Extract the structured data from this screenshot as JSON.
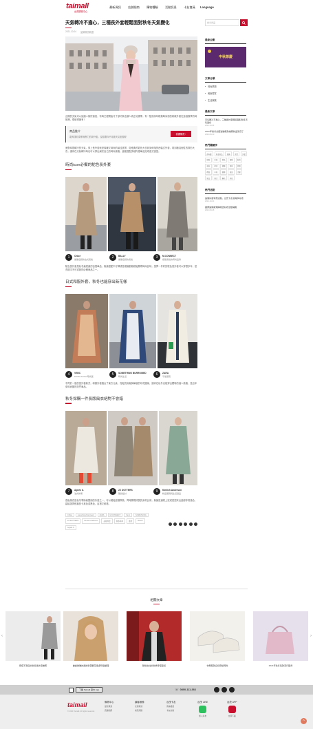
{
  "header": {
    "logo_text": "taimall",
    "logo_sub": "台茂購物中心",
    "nav": [
      "最新資訊",
      "店舖指南",
      "購物體驗",
      "活動訊息",
      "卡友會員",
      "Language"
    ]
  },
  "article": {
    "title": "天氣轉冷不擔心，三種長外套輕鬆面對秋冬天氣變化",
    "meta": [
      "2021.10.04",
      "品牌資訊精選"
    ],
    "intro": "近期的天氣可以說讓人無所適從，有時已經開始冷了卻又無法讓人真正地換季，有一點保持年輕與時尚感的精緻外套在這個換季的時節裡，很值得擁有！",
    "cta": {
      "title": "商品推介",
      "desc": "能夠讓你換季無壓力的新外套，還想要你不用被天氣困擾喔",
      "button": "我要購買 ›"
    },
    "intro2": "面對時間轉冷的天氣，穿上長外套就是保暖又時尚的最佳選擇，從經典的駝色大衣到到俐落的西裝式外套，再到極具個性的廓形大衣，讓你在天氣轉冷時也可以穿出屬於自己的時尚風格，還能搭配多種內搭單品完成各式造型。",
    "sections": [
      {
        "title": "時尚icon必備的駝色長外套",
        "brands": [
          {
            "num": "1",
            "name": "Chloé",
            "desc": "優雅低調的法式風格"
          },
          {
            "num": "2",
            "name": "BALLY",
            "desc": "優雅低調的風格"
          },
          {
            "num": "3",
            "name": "M.CONNECT",
            "desc": "極簡風格的時尚品牌"
          }
        ],
        "text": "駝色長外套是秋冬最經典的百搭單品，無論搭配牛仔褲或是裙裝都能輕鬆展現時尚品味，選擇一件好的駝色長外套可以穿很多年，是衣櫥中不可或缺的必備單品之一。"
      },
      {
        "title": "日式和服外套，秋冬也能穿出新花樣",
        "brands": [
          {
            "num": "4",
            "name": "VENC",
            "desc": "MODA ALISA 時尚選"
          },
          {
            "num": "5",
            "name": "SOMETHING BURROWED",
            "desc": "時尚生活"
          },
          {
            "num": "6",
            "name": "ZARA",
            "desc": "平價潮流"
          }
        ],
        "text": "不同於一般的長外套款式，和服外套融合了東方元素，寬鬆的剪裁與華麗的印花圖案，讓你在秋冬也能穿出獨特的個人風格，是近年來時尚圈的熱門單品。"
      },
      {
        "title": "秋冬採購一件長版風衣絕對不會錯",
        "brands": [
          {
            "num": "7",
            "name": "Agnès b.",
            "desc": "法式休閒"
          },
          {
            "num": "8",
            "name": "ZZ DOTTERS",
            "desc": "獨創設計"
          },
          {
            "num": "9",
            "name": "Kimiich Anderson",
            "desc": "精品服飾與生活選品"
          }
        ],
        "text": "長版風衣是秋冬季節最實用的外套之一，可以輕鬆遮擋寒風，同時展現修長的身材比例，無論是通勤上班或是週末出遊都非常適合，建議選擇經典的卡其色或黑色，百搭又耐看。"
      }
    ],
    "tags": [
      "Chloé",
      "something Burrowed",
      "ZARA",
      "M.CONNECT",
      "Venc",
      "SOMETHING",
      "ZZ DOTTERS",
      "Kimiich Anderson",
      "長版外套",
      "秋冬時尚",
      "風衣",
      "BALLY",
      "Agnès b."
    ]
  },
  "sidebar": {
    "search_placeholder": "搜尋商品",
    "section_recommend": "最新企劃",
    "banner_text": "中秋節慶",
    "section_category": "文章分類",
    "categories": [
      "時尚購物",
      "美食饗宴",
      "生活娛樂"
    ],
    "section_latest": "最新文章",
    "latest": [
      {
        "title": "天氣轉冷不擔心，三種長外套輕鬆面對秋冬天氣變化",
        "date": "2021-10-04"
      },
      {
        "title": "2021年秋冬必搭運動鞋款推薦新品到貨了",
        "date": "2021-09-30"
      }
    ],
    "section_keywords": "熱門關鍵字",
    "keywords": [
      "週年慶",
      "秋冬新品",
      "服飾",
      "美食",
      "外套",
      "保養",
      "彩妝",
      "精品",
      "運動",
      "鞋款",
      "童裝",
      "家居",
      "餐廳",
      "咖啡",
      "甜點",
      "禮盒",
      "中秋",
      "優惠",
      "會員",
      "活動",
      "新品",
      "限定",
      "聯名",
      "折扣"
    ],
    "section_events": "熱門活動",
    "events": [
      {
        "title": "連假好康特惠活動，台茂卡友會員享好禮",
        "date": "2021-10-01"
      },
      {
        "title": "國慶連假歡樂購物送好禮活動開跑",
        "date": "2021-09-28"
      }
    ]
  },
  "related": {
    "heading": "相關文章",
    "cards": [
      "穿搭不落伍的秋冬長外套推薦",
      "誰說優雅的長捲髮需要花很多時間整理",
      "職場女性的秋季穿搭靈感",
      "休閒鞋款這樣穿最時尚",
      "2021年秋冬包款流行趨勢"
    ]
  },
  "footer": {
    "app_text": "下載 Taimall 官方 App",
    "phone": "0800-111-366",
    "columns": [
      {
        "title": "購物中心",
        "links": [
          "最新資訊",
          "店舖指南"
        ]
      },
      {
        "title": "顧客服務",
        "links": [
          "交通資訊",
          "常見問題"
        ]
      },
      {
        "title": "台茂卡友",
        "links": [
          "會員權益",
          "卡友好康"
        ]
      },
      {
        "title": "台茂 LINE",
        "links": [
          "加入好友"
        ]
      },
      {
        "title": "台茂 APP",
        "links": [
          "立即下載"
        ]
      }
    ],
    "copyright": "© 2021 Taimall. All rights reserved."
  }
}
